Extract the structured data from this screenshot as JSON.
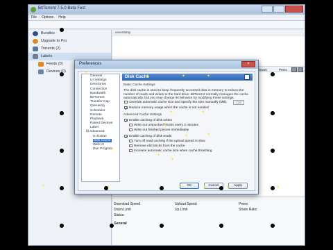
{
  "app": {
    "title": "BitTorrent 7.5.0  Beta Fest",
    "menu": [
      "File",
      "Options",
      "Help"
    ]
  },
  "sidebar": {
    "items": [
      {
        "label": "Bundles",
        "icon": "bundles-icon",
        "color": "#2a4f8f"
      },
      {
        "label": "Upgrade to Pro",
        "icon": "pro-icon",
        "color": "#d88a1e"
      },
      {
        "label": "Torrents (2)",
        "icon": "torrents-icon",
        "color": "#597a9c"
      },
      {
        "label": "Labels",
        "icon": "labels-icon",
        "color": "#6e7d8f"
      },
      {
        "label": "Feeds (0)",
        "icon": "feeds-icon",
        "color": "#e08a2a"
      },
      {
        "label": "Devices (0)",
        "icon": "devices-icon",
        "color": "#6a86a8"
      }
    ]
  },
  "torrent_list": {
    "header": "uncertainty",
    "columns": [
      "ETA",
      "Seeds",
      "Peers"
    ]
  },
  "info_panel": {
    "download_speed": "Download Speed",
    "upload_speed": "Upload Speed",
    "peers": "Peers",
    "down_limit": "Down Limit",
    "up_limit": "Up Limit",
    "share_ratio": "Share Ratio",
    "status": "Status:",
    "general": "General"
  },
  "prefs": {
    "title": "Preferences",
    "tree": [
      {
        "label": "General",
        "level": 1
      },
      {
        "label": "UI Settings",
        "level": 1
      },
      {
        "label": "Directories",
        "level": 1
      },
      {
        "label": "Connection",
        "level": 1
      },
      {
        "label": "Bandwidth",
        "level": 1
      },
      {
        "label": "BitTorrent",
        "level": 1
      },
      {
        "label": "Transfer Cap",
        "level": 1
      },
      {
        "label": "Queueing",
        "level": 1
      },
      {
        "label": "Scheduler",
        "level": 1
      },
      {
        "label": "Remote",
        "level": 1
      },
      {
        "label": "Playback",
        "level": 1
      },
      {
        "label": "Paired Devices",
        "level": 1
      },
      {
        "label": "Label",
        "level": 1
      },
      {
        "label": "Advanced",
        "level": 0
      },
      {
        "label": "UI Extras",
        "level": 2
      },
      {
        "label": "Disk Cache",
        "level": 2,
        "selected": true
      },
      {
        "label": "Web UI",
        "level": 2
      },
      {
        "label": "Run Program",
        "level": 2
      }
    ],
    "panel_title": "Disk Cache",
    "basic_group": "Basic Cache Settings",
    "basic_text": "The disk cache is used to keep frequently accessed data in memory to reduce the number of reads and writes to the hard drive. BitTorrent normally manages the cache automatically, but you may change its behavior by modifying these settings.",
    "override_label": "Override automatic cache size and specify the size manually (MB):",
    "override_checked": false,
    "cache_size": "128",
    "reduce_label": "Reduce memory usage when the cache is not needed",
    "reduce_checked": true,
    "advanced_group": "Advanced Cache Settings",
    "enable_write_label": "Enable caching of disk writes",
    "enable_write_checked": true,
    "write_untouched_label": "Write out untouched blocks every 2 minutes",
    "write_untouched_checked": false,
    "write_finished_label": "Write out finished pieces immediately",
    "write_finished_checked": false,
    "enable_read_label": "Enable caching of disk reads",
    "enable_read_checked": true,
    "turn_off_read_label": "Turn off read caching if the upload speed is slow",
    "turn_off_read_checked": false,
    "remove_old_label": "Remove old blocks from the cache",
    "remove_old_checked": false,
    "increase_auto_label": "Increase automatic cache size when cache thrashing",
    "increase_auto_checked": false,
    "ok": "OK",
    "cancel": "Cancel",
    "apply": "Apply"
  }
}
